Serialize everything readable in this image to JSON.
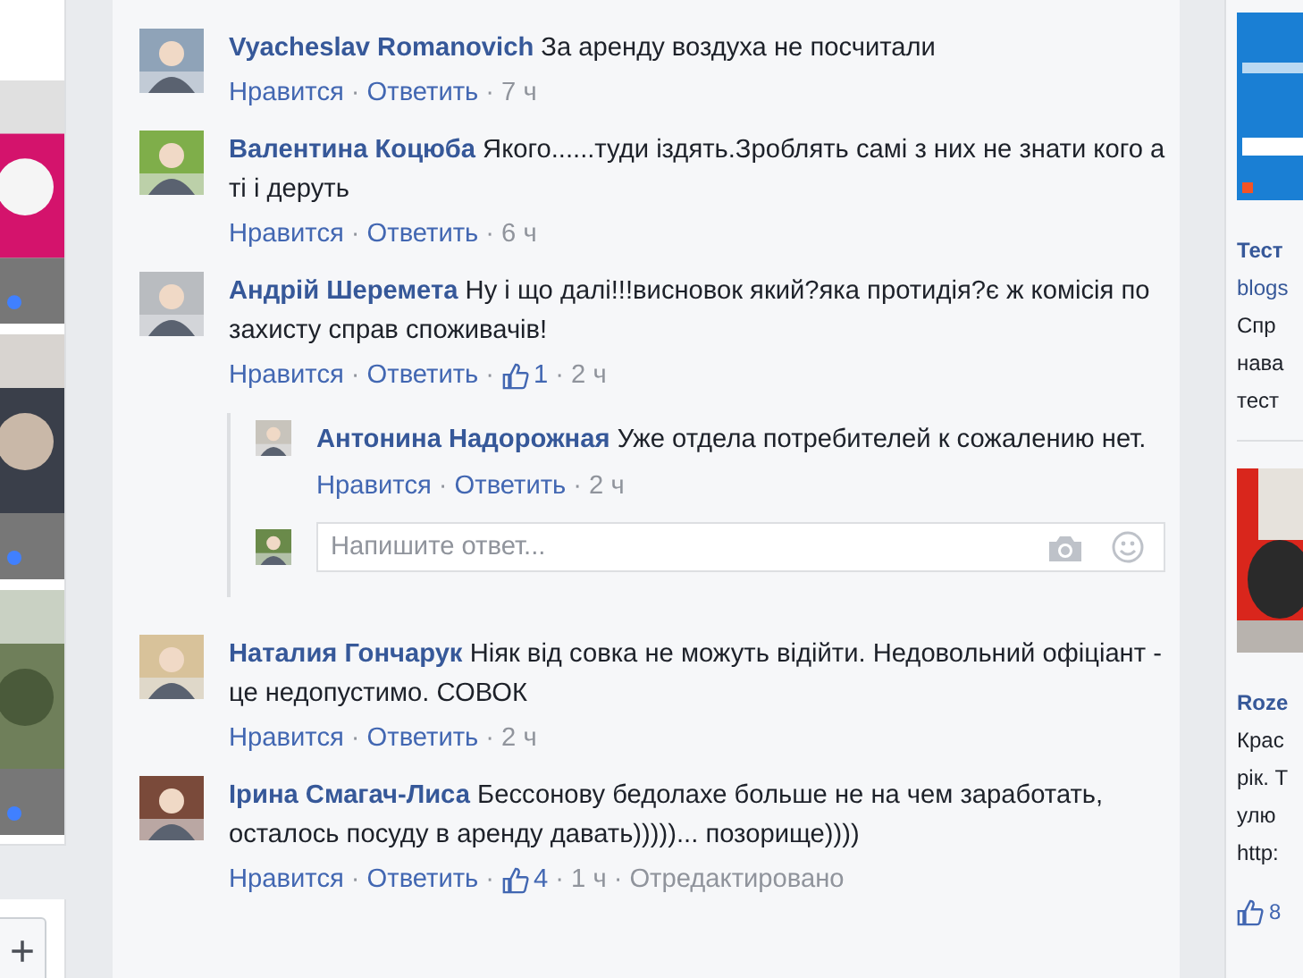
{
  "left_column": {
    "add_button": "+"
  },
  "comments": [
    {
      "author": "Vyacheslav Romanovich",
      "text": "За аренду воздуха не посчитали",
      "like": "Нравится",
      "reply": "Ответить",
      "time": "7 ч",
      "separator": "·"
    },
    {
      "author": "Валентина Коцюба",
      "text": "Якого......туди іздять.Зроблять самі з них не знати кого а ті і деруть",
      "like": "Нравится",
      "reply": "Ответить",
      "time": "6 ч",
      "separator": "·"
    },
    {
      "author": "Андрій Шеремета",
      "text": "Ну і що далі!!!висновок який?яка протидія?є ж комісія по захисту справ споживачів!",
      "like": "Нравится",
      "reply": "Ответить",
      "likes": "1",
      "time": "2 ч",
      "separator": "·",
      "replies": [
        {
          "author": "Антонина Надорожная",
          "text": "Уже отдела потребителей к сожалению нет.",
          "like": "Нравится",
          "reply": "Ответить",
          "time": "2 ч",
          "separator": "·"
        }
      ],
      "reply_box": {
        "placeholder": "Напишите ответ..."
      }
    },
    {
      "author": "Наталия Гончарук",
      "text": "Ніяк від совка не можуть відійти. Недовольний офіціант - це недопустимо. СОВОК",
      "like": "Нравится",
      "reply": "Ответить",
      "time": "2 ч",
      "separator": "·"
    },
    {
      "author": "Ірина Смагач-Лиса",
      "text": "Бессонову бедолахе больше не на чем заработать, осталось посуду в аренду давать)))))... позорище))))",
      "like": "Нравится",
      "reply": "Ответить",
      "likes": "4",
      "time": "1 ч",
      "edited": "Отредактировано",
      "separator": "·"
    }
  ],
  "right_column": {
    "ads": [
      {
        "title": "Тест",
        "domain": "blogs",
        "lines": [
          "Спр",
          "нава",
          "тест"
        ]
      },
      {
        "title": "Roze",
        "lines": [
          "Крас",
          "рік. Т",
          "улю",
          "http:"
        ],
        "likes": "8"
      }
    ]
  }
}
